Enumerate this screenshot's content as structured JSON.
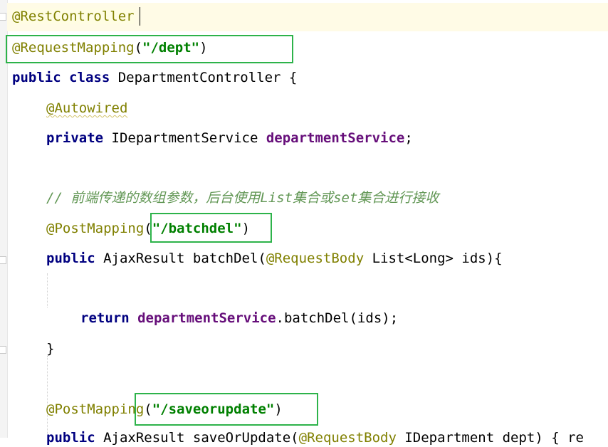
{
  "editor": {
    "lines": [
      {
        "id": "l1",
        "segments": [
          {
            "cls": "ann",
            "text": "@RestController"
          }
        ]
      },
      {
        "id": "l2",
        "segments": [
          {
            "cls": "ann",
            "text": "@RequestMapping"
          },
          {
            "cls": "",
            "text": "("
          },
          {
            "cls": "str",
            "text": "\"/dept\""
          },
          {
            "cls": "",
            "text": ")"
          }
        ]
      },
      {
        "id": "l3",
        "segments": [
          {
            "cls": "kw",
            "text": "public class "
          },
          {
            "cls": "",
            "text": "DepartmentController {"
          }
        ]
      },
      {
        "id": "l4",
        "segments": [
          {
            "cls": "ann squig",
            "text": "@Autowired"
          }
        ]
      },
      {
        "id": "l5",
        "segments": [
          {
            "cls": "kw",
            "text": "private "
          },
          {
            "cls": "",
            "text": "IDepartmentService "
          },
          {
            "cls": "field",
            "text": "departmentService"
          },
          {
            "cls": "",
            "text": ";"
          }
        ]
      },
      {
        "id": "l6",
        "segments": []
      },
      {
        "id": "l7",
        "segments": [
          {
            "cls": "cmt",
            "text": "// 前端传递的数组参数，后台使用List集合或set集合进行接收"
          }
        ]
      },
      {
        "id": "l8",
        "segments": [
          {
            "cls": "ann",
            "text": "@PostMapping"
          },
          {
            "cls": "",
            "text": "("
          },
          {
            "cls": "str",
            "text": "\"/batchdel\""
          },
          {
            "cls": "",
            "text": ")"
          }
        ]
      },
      {
        "id": "l9",
        "segments": [
          {
            "cls": "kw",
            "text": "public "
          },
          {
            "cls": "",
            "text": "AjaxResult batchDel("
          },
          {
            "cls": "ann",
            "text": "@RequestBody "
          },
          {
            "cls": "",
            "text": "List<Long> ids){"
          }
        ]
      },
      {
        "id": "l10",
        "segments": []
      },
      {
        "id": "l11",
        "segments": [
          {
            "cls": "kw",
            "text": "return "
          },
          {
            "cls": "field",
            "text": "departmentService"
          },
          {
            "cls": "",
            "text": ".batchDel(ids);"
          }
        ]
      },
      {
        "id": "l12",
        "segments": [
          {
            "cls": "",
            "text": "}"
          }
        ]
      },
      {
        "id": "l13",
        "segments": []
      },
      {
        "id": "l14",
        "segments": [
          {
            "cls": "ann",
            "text": "@PostMapping"
          },
          {
            "cls": "",
            "text": "("
          },
          {
            "cls": "str",
            "text": "\"/saveorupdate\""
          },
          {
            "cls": "",
            "text": ")"
          }
        ]
      },
      {
        "id": "l15",
        "segments": [
          {
            "cls": "kw",
            "text": "public "
          },
          {
            "cls": "",
            "text": "AjaxResult saveOrUpdate("
          },
          {
            "cls": "ann",
            "text": "@RequestBody "
          },
          {
            "cls": "",
            "text": "IDepartment dept) { re"
          }
        ]
      }
    ]
  },
  "annotation_color": "#2db34a"
}
